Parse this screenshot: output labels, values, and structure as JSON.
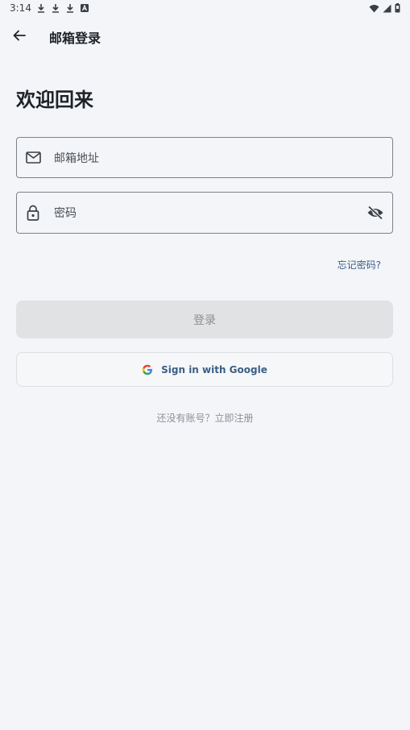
{
  "status_bar": {
    "time": "3:14"
  },
  "app_bar": {
    "title": "邮箱登录"
  },
  "welcome": "欢迎回来",
  "email": {
    "placeholder": "邮箱地址",
    "icon": "mail-icon"
  },
  "password": {
    "placeholder": "密码",
    "icon": "lock-icon",
    "toggle_icon": "visibility-off-icon"
  },
  "forgot_password": "忘记密码?",
  "login_button": "登录",
  "google_button": "Sign in with Google",
  "register_link": "还没有账号？立即注册",
  "colors": {
    "background": "#f3f5f8",
    "link": "#3a5f86",
    "button_disabled": "#e1e2e4"
  }
}
